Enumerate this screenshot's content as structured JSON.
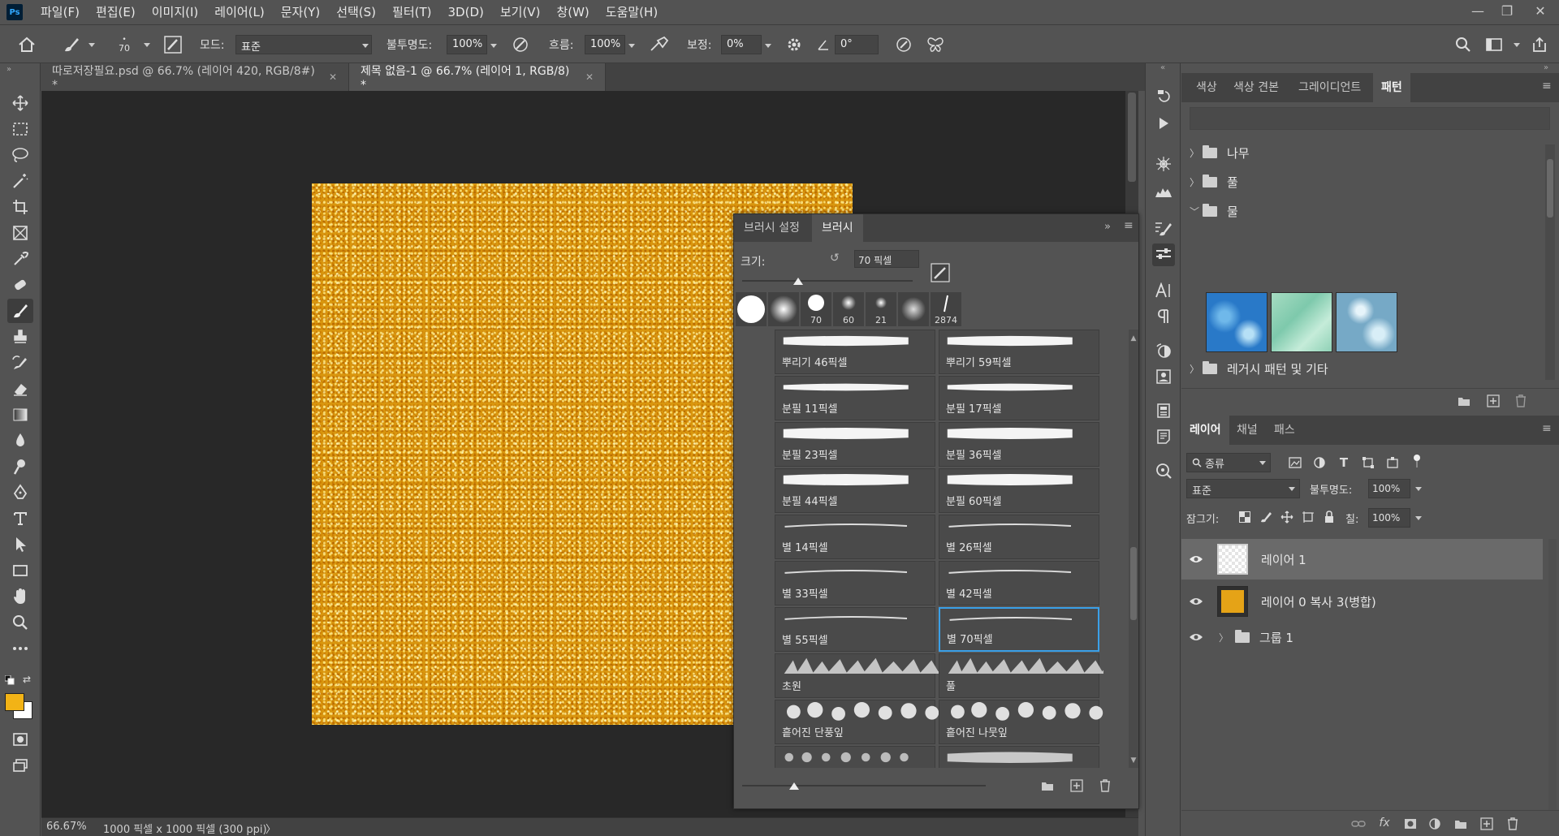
{
  "app": {
    "logo": "Ps"
  },
  "menu": [
    "파일(F)",
    "편집(E)",
    "이미지(I)",
    "레이어(L)",
    "문자(Y)",
    "선택(S)",
    "필터(T)",
    "3D(D)",
    "보기(V)",
    "창(W)",
    "도움말(H)"
  ],
  "options": {
    "brush_size": "70",
    "mode_label": "모드:",
    "mode_value": "표준",
    "opacity_label": "불투명도:",
    "opacity_value": "100%",
    "flow_label": "흐름:",
    "flow_value": "100%",
    "smoothing_label": "보정:",
    "smoothing_value": "0%",
    "angle_value": "0°"
  },
  "tabs": [
    {
      "label": "따로저장필요.psd @ 66.7% (레이어 420, RGB/8#) *"
    },
    {
      "label": "제목 없음-1 @ 66.7% (레이어 1, RGB/8) *"
    }
  ],
  "status": {
    "zoom": "66.67%",
    "doc_info": "1000 픽셀 x 1000 픽셀 (300 ppi)",
    "arrow": "〉"
  },
  "brush_panel": {
    "tabs": [
      "브러시 설정",
      "브러시"
    ],
    "size_label": "크기:",
    "size_value": "70 픽셀",
    "size_slider_fraction": 0.33,
    "tips": [
      "70",
      "60",
      "21",
      "2874"
    ],
    "brushes": [
      {
        "label": "뿌리기 46픽셀"
      },
      {
        "label": "뿌리기 59픽셀"
      },
      {
        "label": "분필 11픽셀"
      },
      {
        "label": "분필 17픽셀"
      },
      {
        "label": "분필 23픽셀"
      },
      {
        "label": "분필 36픽셀"
      },
      {
        "label": "분필 44픽셀"
      },
      {
        "label": "분필 60픽셀"
      },
      {
        "label": "별 14픽셀"
      },
      {
        "label": "별 26픽셀"
      },
      {
        "label": "별 33픽셀"
      },
      {
        "label": "별 42픽셀"
      },
      {
        "label": "별 55픽셀"
      },
      {
        "label": "별 70픽셀"
      },
      {
        "label": "초원"
      },
      {
        "label": "풀"
      },
      {
        "label": "흩어진 단풍잎"
      },
      {
        "label": "흩어진 나뭇잎"
      }
    ],
    "selected_brush": "별 70픽셀"
  },
  "patterns_panel": {
    "tabs": [
      "색상",
      "색상 견본",
      "그레이디언트",
      "패턴"
    ],
    "folders": [
      {
        "label": "나무"
      },
      {
        "label": "풀"
      },
      {
        "label": "물"
      },
      {
        "label": "레거시 패턴 및 기타"
      }
    ]
  },
  "layers_panel": {
    "tabs": [
      "레이어",
      "채널",
      "패스"
    ],
    "filter_label": "종류",
    "blend_mode": "표준",
    "opacity_label": "불투명도:",
    "opacity_value": "100%",
    "lock_label": "잠그기:",
    "fill_label": "칠:",
    "fill_value": "100%",
    "layers": [
      {
        "name": "레이어 1"
      },
      {
        "name": "레이어 0 복사 3(병합)"
      },
      {
        "name": "그룹 1"
      }
    ]
  },
  "colors": {
    "foreground": "#f2b316",
    "background": "#ffffff",
    "accent": "#3aa0e8"
  }
}
